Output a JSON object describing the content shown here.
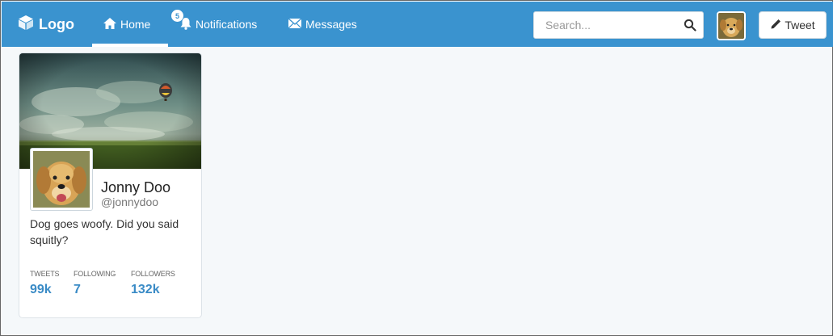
{
  "brand": {
    "label": "Logo"
  },
  "nav": {
    "home": "Home",
    "notifications": "Notifications",
    "notifications_count": "5",
    "messages": "Messages"
  },
  "search": {
    "placeholder": "Search..."
  },
  "tweet_button": {
    "label": "Tweet"
  },
  "profile": {
    "name": "Jonny Doo",
    "handle": "@jonnydoo",
    "bio": "Dog goes woofy. Did you said squitly?",
    "stats": [
      {
        "label": "TWEETS",
        "value": "99k"
      },
      {
        "label": "FOLLOWING",
        "value": "7"
      },
      {
        "label": "FOLLOWERS",
        "value": "132k"
      }
    ]
  },
  "colors": {
    "navbar": "#3a93cf",
    "stat_value": "#3a8bc6",
    "page_background": "#f5f8fa"
  },
  "icons": {
    "brand": "cube-icon",
    "home": "home-icon",
    "notifications": "bell-icon",
    "messages": "envelope-icon",
    "search": "search-icon",
    "tweet": "pencil-icon"
  }
}
